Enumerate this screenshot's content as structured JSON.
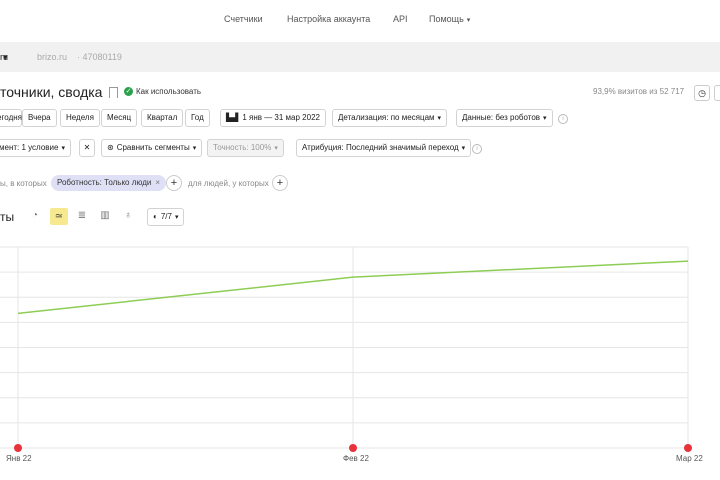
{
  "topnav": {
    "items": [
      "Счетчики",
      "Настройка аккаунта",
      "API",
      "Помощь"
    ]
  },
  "subbar": {
    "site_fragment": "ru",
    "site": "brizo.ru",
    "counter_id": "· 47080119"
  },
  "header": {
    "title": "точники, сводка",
    "howto_label": "Как использовать",
    "visits_text": "93,9% визитов из 52 717"
  },
  "periods": [
    "Сегодня",
    "Вчера",
    "Неделя",
    "Месяц",
    "Квартал",
    "Год"
  ],
  "date_range": "1 янв — 31 мар 2022",
  "detail": "Детализация: по месяцам",
  "data_filter": "Данные: без роботов",
  "segment": {
    "label": "мент: 1 условие",
    "compare_label": "Сравнить сегменты",
    "accuracy_label": "Точность: 100%",
    "attribution_label": "Атрибуция: Последний значимый переход"
  },
  "filters": {
    "prefix": "ы, в которых",
    "chip": "Роботность: Только люди",
    "suffix": "для людей, у которых"
  },
  "chart_toolbar": {
    "title": "ты",
    "series_count": "7/7"
  },
  "chart_data": {
    "type": "line",
    "categories": [
      "Янв 22",
      "Фев 22",
      "Мар 22"
    ],
    "series": [
      {
        "values": [
          0.67,
          0.85,
          0.93
        ],
        "color": "#8dcd55"
      }
    ],
    "ylim": [
      0,
      1
    ],
    "grid": true,
    "annotations": [
      "Янв 22",
      "Фев 22",
      "Мар 22"
    ]
  }
}
